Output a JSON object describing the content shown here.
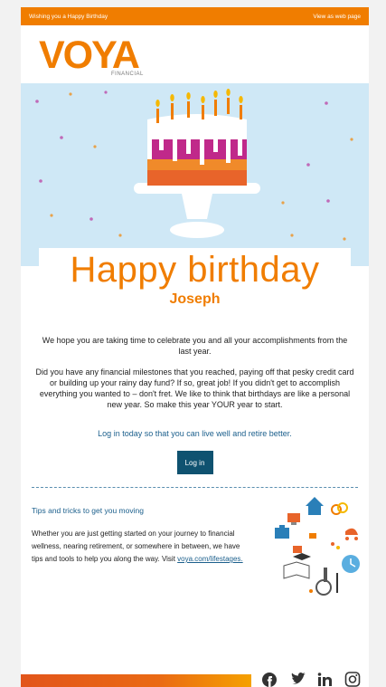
{
  "topbar": {
    "left_text": "Wishing you a Happy Birthday",
    "right_link": "View as web page"
  },
  "logo": {
    "word": "VOYA",
    "sub": "FINANCIAL"
  },
  "greeting": {
    "title": "Happy birthday",
    "name": "Joseph"
  },
  "body": {
    "p1": "We hope you are taking time to celebrate you and all your accomplishments from the last year.",
    "p2": "Did you have any financial milestones that you reached, paying off that pesky credit card or building up your rainy day fund? If so, great job! If you didn't get to accomplish everything you wanted to – don't fret. We like to think that birthdays are like a personal new year. So make this year YOUR year to start.",
    "cta_text": "Log in today so that you can live well and retire better.",
    "login_label": "Log in"
  },
  "tips": {
    "title": "Tips and tricks to get you moving",
    "copy": "Whether you are just getting started on your journey to financial wellness, nearing retirement, or somewhere in between, we have tips and tools to help you along the way. Visit",
    "link": "voya.com/lifestages."
  },
  "social": [
    "facebook-icon",
    "twitter-icon",
    "linkedin-icon",
    "instagram-icon"
  ],
  "colors": {
    "brand_orange": "#f07d00",
    "sky": "#cfe8f6",
    "button_navy": "#0f5270",
    "link_blue": "#1b5f8c",
    "cake_magenta": "#c0298a",
    "cake_orange": "#e8642a"
  }
}
